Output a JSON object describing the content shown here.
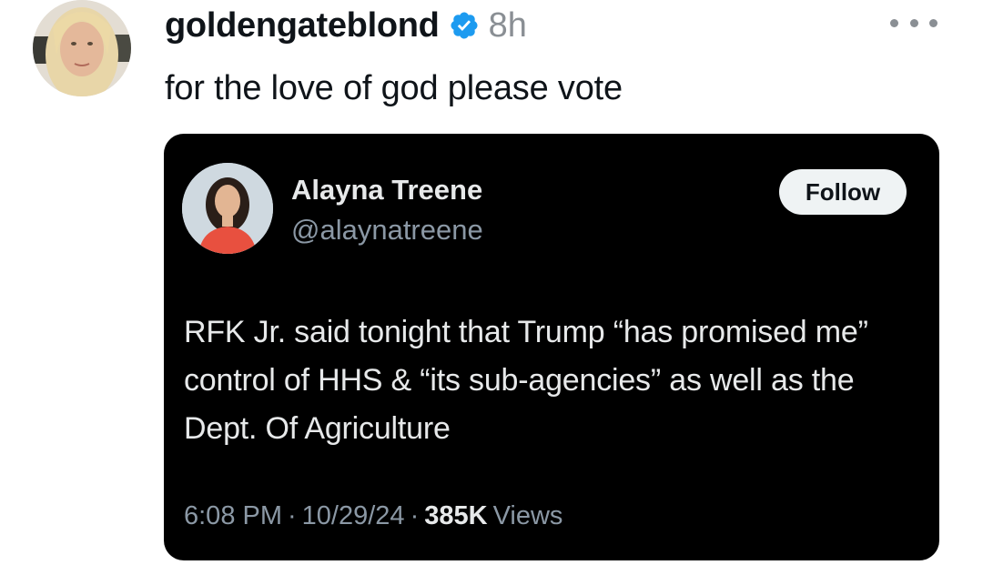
{
  "post": {
    "username": "goldengateblond",
    "verified": true,
    "time": "8h",
    "text": "for the love of god please vote",
    "icons": {
      "avatar": "avatar-photo",
      "verified": "verified-badge-icon",
      "more": "more-options-icon"
    }
  },
  "quote": {
    "name": "Alayna Treene",
    "handle": "@alaynatreene",
    "follow_label": "Follow",
    "text": "RFK Jr. said tonight that Trump “has promised me” control of HHS & “its sub-agencies” as well as the Dept. Of Agriculture",
    "time": "6:08 PM",
    "separator": "·",
    "date": "10/29/24",
    "views_count": "385K",
    "views_label": "Views"
  },
  "colors": {
    "verified": "#1d9bf0",
    "card_bg": "#000000",
    "muted": "#8b98a5"
  }
}
